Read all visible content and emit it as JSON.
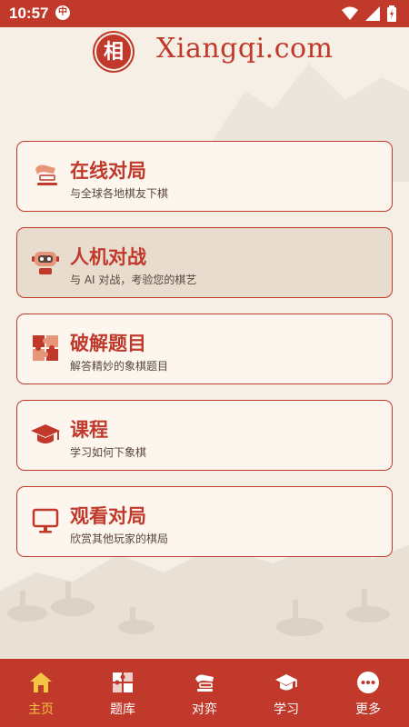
{
  "status_bar": {
    "time": "10:57",
    "notification_badge": "中"
  },
  "header": {
    "logo_char": "相",
    "brand": "Xiangqi.com"
  },
  "menu": [
    {
      "title": "在线对局",
      "subtitle": "与全球各地棋友下棋",
      "icon": "online-play-icon",
      "active": false
    },
    {
      "title": "人机对战",
      "subtitle": "与 AI 对战，考验您的棋艺",
      "icon": "robot-icon",
      "active": true
    },
    {
      "title": "破解题目",
      "subtitle": "解答精妙的象棋题目",
      "icon": "puzzle-icon",
      "active": false
    },
    {
      "title": "课程",
      "subtitle": "学习如何下象棋",
      "icon": "graduation-cap-icon",
      "active": false
    },
    {
      "title": "观看对局",
      "subtitle": "欣赏其他玩家的棋局",
      "icon": "monitor-icon",
      "active": false
    }
  ],
  "bottom_nav": [
    {
      "label": "主页",
      "icon": "home-icon",
      "active": true
    },
    {
      "label": "题库",
      "icon": "puzzle-icon",
      "active": false
    },
    {
      "label": "对弈",
      "icon": "play-icon",
      "active": false
    },
    {
      "label": "学习",
      "icon": "graduation-cap-icon",
      "active": false
    },
    {
      "label": "更多",
      "icon": "more-icon",
      "active": false
    }
  ],
  "colors": {
    "accent": "#c0392b",
    "background": "#f5efe6",
    "card": "#fcf6ee",
    "active_card": "#e8dccf",
    "nav_active": "#f4c542"
  }
}
